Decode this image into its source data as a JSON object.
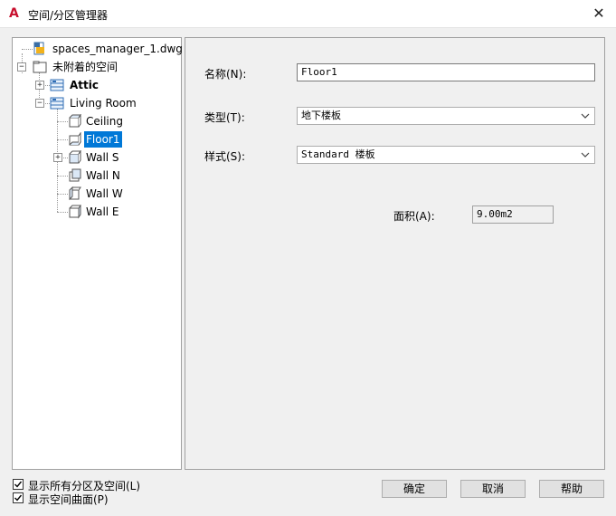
{
  "window": {
    "title": "空间/分区管理器",
    "logo_letter": "A",
    "close_label": "✕"
  },
  "tree": {
    "root": "spaces_manager_1.dwg",
    "unattached": "未附着的空间",
    "zone_attic": "Attic",
    "zone_living": "Living Room",
    "items": [
      "Ceiling",
      "Floor1",
      "Wall S",
      "Wall N",
      "Wall W",
      "Wall E"
    ],
    "selected": "Floor1"
  },
  "detail": {
    "name_label": "名称(N):",
    "name_value": "Floor1",
    "type_label": "类型(T):",
    "type_value": "地下楼板",
    "style_label": "样式(S):",
    "style_value": "Standard 楼板",
    "area_label": "面积(A):",
    "area_value": "9.00m2"
  },
  "options": {
    "show_all_zones": "显示所有分区及空间(L)",
    "show_all_zones_checked": true,
    "show_space_surfaces": "显示空间曲面(P)",
    "show_space_surfaces_checked": true
  },
  "buttons": {
    "ok": "确定",
    "cancel": "取消",
    "help": "帮助"
  }
}
